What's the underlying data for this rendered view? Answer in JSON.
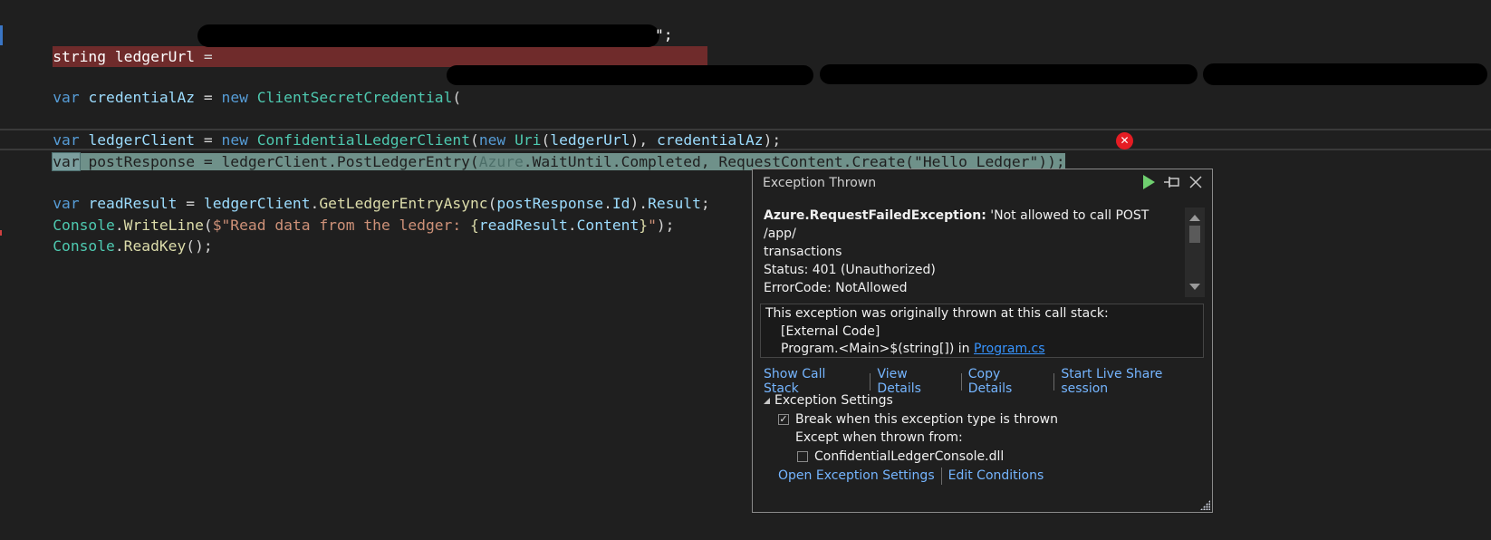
{
  "editor": {
    "lines": {
      "l1": {
        "kw": "string",
        "var": "ledgerUrl",
        "op": " = ",
        "tail": "\";"
      },
      "l3": {
        "kw": "var",
        "var": "credentialAz",
        "op": " = ",
        "new": "new",
        "type": "ClientSecretCredential",
        "paren": "("
      },
      "l5": {
        "kw": "var",
        "var": "ledgerClient",
        "op": " = ",
        "new": "new",
        "type": "ConfidentialLedgerClient",
        "p1": "(",
        "new2": "new",
        "uri": "Uri",
        "p2": "(",
        "arg1": "ledgerUrl",
        "p3": "), ",
        "arg2": "credentialAz",
        "end": ");"
      },
      "l6": {
        "kw": "var",
        "rest1": " postResponse = ledgerClient.PostLedgerEntry(",
        "ns": "Azure",
        "rest2": ".WaitUntil.Completed, RequestContent.Create(\"Hello Ledger\"));"
      },
      "l8": {
        "kw": "var",
        "var": "readResult",
        "op": " = ",
        "obj": "ledgerClient",
        "dot": ".",
        "method": "GetLedgerEntryAsync",
        "p1": "(",
        "arg": "postResponse",
        "dot2": ".",
        "prop": "Id",
        "p2": ").",
        "result": "Result",
        "end": ";"
      },
      "l9": {
        "type": "Console",
        "dot": ".",
        "method": "WriteLine",
        "p1": "(",
        "str1": "$\"Read data from the ledger: ",
        "b1": "{",
        "arg": "readResult",
        "dot2": ".",
        "prop": "Content",
        "b2": "}",
        "str2": "\"",
        "end": ");"
      },
      "l10": {
        "type": "Console",
        "dot": ".",
        "method": "ReadKey",
        "end": "();"
      }
    },
    "error_glyph": "✕"
  },
  "exception_popup": {
    "title": "Exception Thrown",
    "controls": {
      "continue": "▶",
      "pin": "⊣□",
      "close": "✕"
    },
    "message": {
      "type": "Azure.RequestFailedException:",
      "text": " 'Not allowed to call POST /app/",
      "line2": "transactions",
      "line3": "Status: 401 (Unauthorized)",
      "line4": "ErrorCode: NotAllowed"
    },
    "call_stack": {
      "header": "This exception was originally thrown at this call stack:",
      "frames": [
        "[External Code]",
        "Program.<Main>$(string[]) in "
      ],
      "file_link": "Program.cs"
    },
    "actions": [
      "Show Call Stack",
      "View Details",
      "Copy Details",
      "Start Live Share session"
    ],
    "settings": {
      "header": "Exception Settings",
      "break_label": "Break when this exception type is thrown",
      "break_checked": true,
      "except_label": "Except when thrown from:",
      "module_label": "ConfidentialLedgerConsole.dll",
      "module_checked": false,
      "check_glyph": "✓",
      "links": [
        "Open Exception Settings",
        "Edit Conditions"
      ]
    }
  },
  "colors": {
    "error_red": "#e51c23",
    "continue_green": "#6fcf6f",
    "link_blue": "#3794ff"
  }
}
